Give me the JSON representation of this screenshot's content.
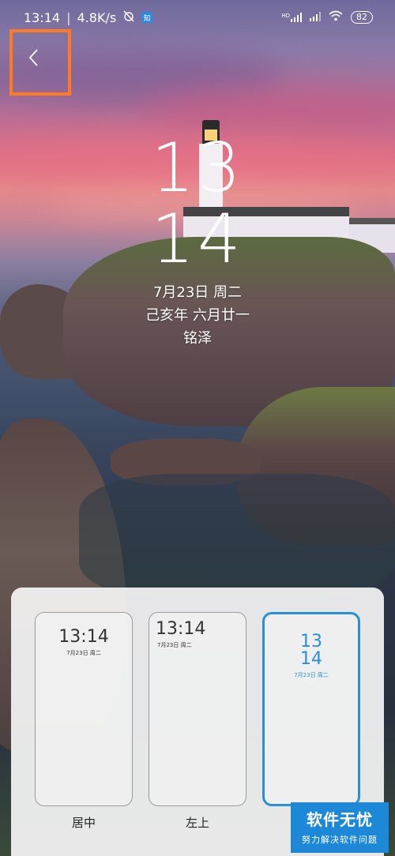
{
  "status_bar": {
    "time": "13:14",
    "net_speed": "4.8K/s",
    "app_badge": "知",
    "hd_label": "HD",
    "battery": "82"
  },
  "back_button": {
    "icon": "chevron-left-icon",
    "highlight_color": "#ff7a22"
  },
  "clock": {
    "hour": "13",
    "minute": "14",
    "date": "7月23日  周二",
    "lunar": "己亥年  六月廿一",
    "owner": "铭泽"
  },
  "styles": {
    "accent_color": "#2a8fd8",
    "options": [
      {
        "label": "居中",
        "time": "13:14",
        "date": "7月23日  周二",
        "selected": false
      },
      {
        "label": "左上",
        "time": "13:14",
        "date": "7月23日  周二",
        "selected": false
      },
      {
        "label": "",
        "hour": "13",
        "minute": "14",
        "date": "7月23日  周二",
        "selected": true
      }
    ]
  },
  "watermark": {
    "title": "软件无忧",
    "subtitle": "努力解决软件问题"
  }
}
